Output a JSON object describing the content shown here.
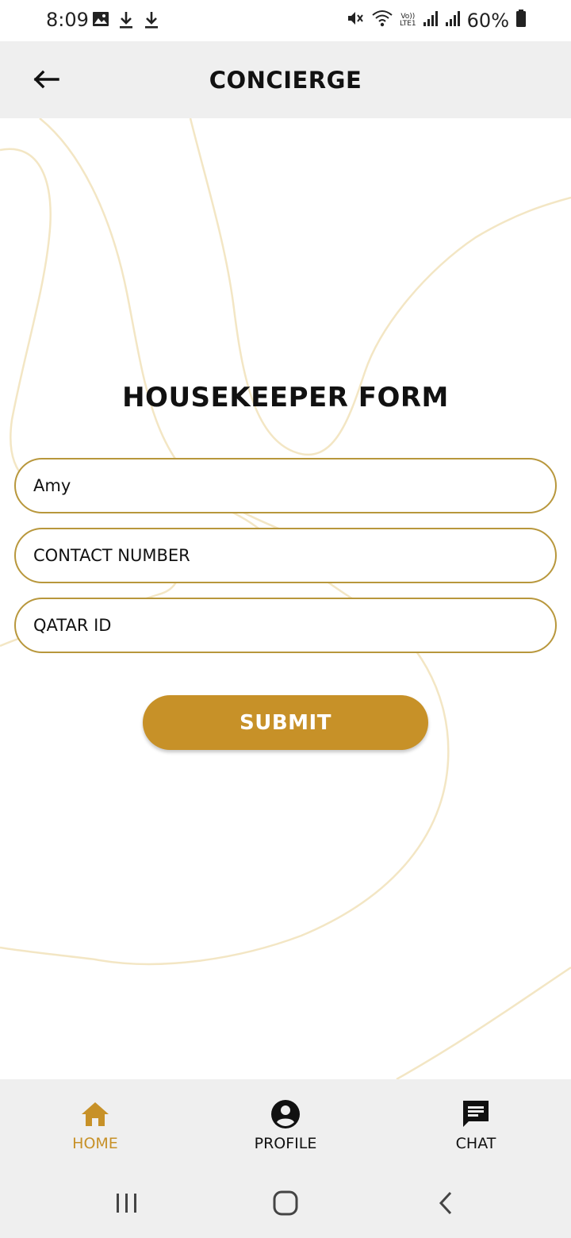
{
  "status_bar": {
    "time": "8:09",
    "left_icons": [
      "gallery-icon",
      "download-icon",
      "download-icon"
    ],
    "right_icons": [
      "mute-icon",
      "wifi-icon",
      "volte-icon",
      "signal-icon",
      "signal-icon",
      "battery-icon"
    ],
    "volte_line1": "Vo))",
    "volte_line2": "LTE1",
    "battery_percent": "60%"
  },
  "app_bar": {
    "back_icon": "arrow-left-icon",
    "title": "CONCIERGE"
  },
  "form": {
    "title": "HOUSEKEEPER FORM",
    "name_value": "Amy",
    "contact_placeholder": "CONTACT NUMBER",
    "qatar_id_placeholder": "QATAR ID",
    "submit_label": "SUBMIT"
  },
  "bottom_nav": {
    "items": [
      {
        "label": "HOME",
        "icon": "home-icon",
        "active": true
      },
      {
        "label": "PROFILE",
        "icon": "account-circle-icon",
        "active": false
      },
      {
        "label": "CHAT",
        "icon": "chat-icon",
        "active": false
      }
    ]
  },
  "system_nav": {
    "buttons": [
      "recents-icon",
      "home-circle-icon",
      "back-chevron-icon"
    ]
  },
  "colors": {
    "accent": "#c79128",
    "field_border": "#b8973c",
    "bar_background": "#efefef",
    "swirl": "#f3e6c4"
  }
}
